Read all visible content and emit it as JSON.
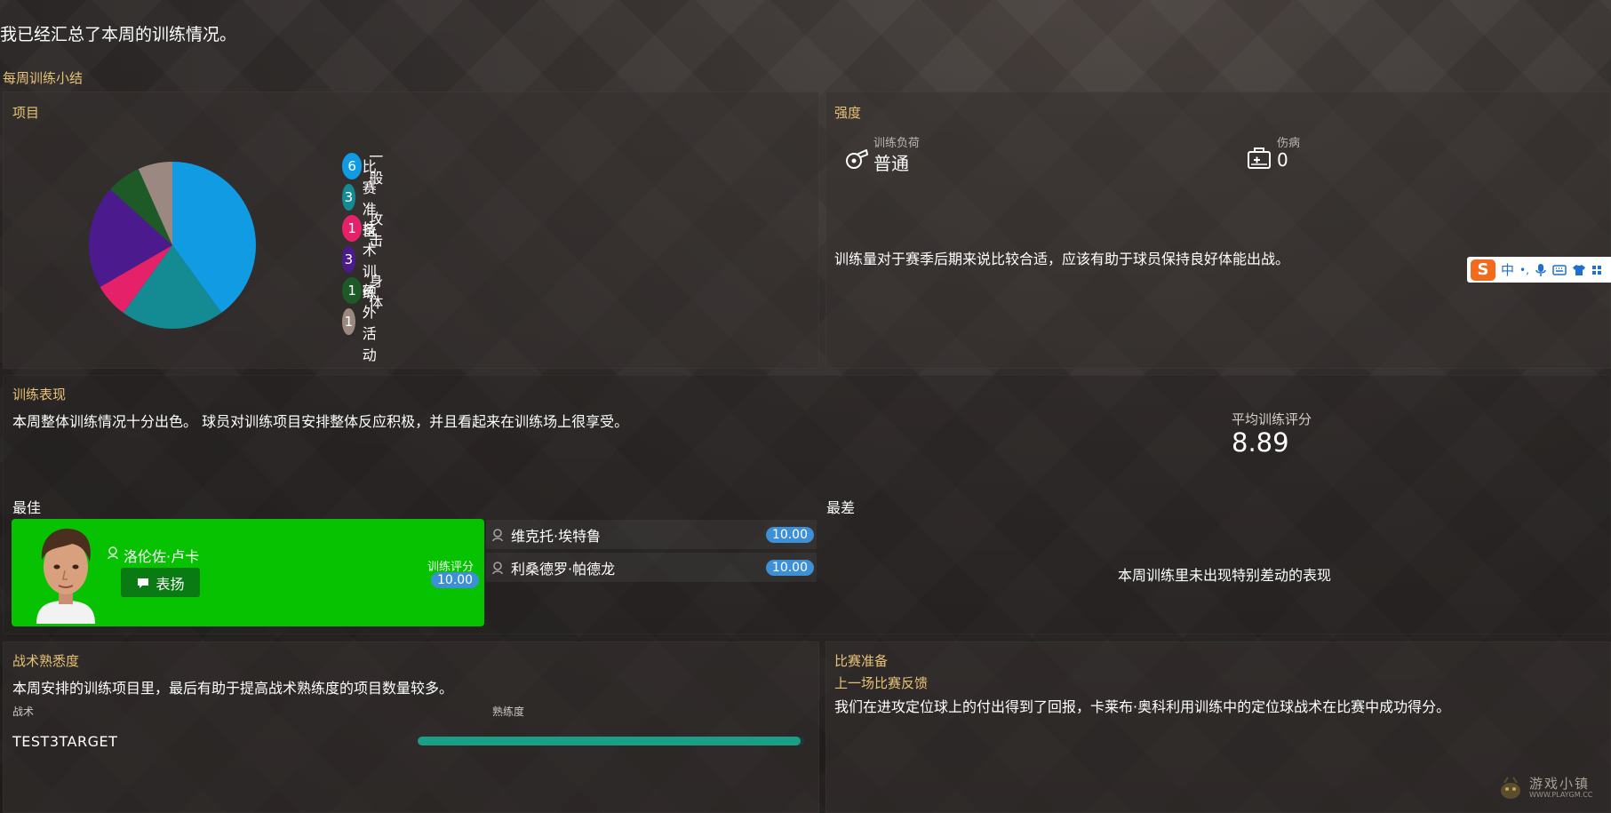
{
  "header": {
    "message": "我已经汇总了本周的训练情况。",
    "summary_title": "每周训练小结"
  },
  "sessions": {
    "title": "项目",
    "items": [
      {
        "count": "6",
        "label": "一般",
        "color": "#109be3"
      },
      {
        "count": "3",
        "label": "比赛准备",
        "color": "#148a93"
      },
      {
        "count": "1",
        "label": "攻击",
        "color": "#e5216a"
      },
      {
        "count": "3",
        "label": "技术训练",
        "color": "#4b1b8e"
      },
      {
        "count": "1",
        "label": "身体",
        "color": "#1e5a28"
      },
      {
        "count": "1",
        "label": "额外活动",
        "color": "#9b8880"
      }
    ]
  },
  "intensity": {
    "title": "强度",
    "load_caption": "训练负荷",
    "load_value": "普通",
    "injury_caption": "伤病",
    "injury_value": "0",
    "comment": "训练量对于赛季后期来说比较合适，应该有助于球员保持良好体能出战。"
  },
  "performance": {
    "title": "训练表现",
    "comment": "本周整体训练情况十分出色。 球员对训练项目安排整体反应积极，并且看起来在训练场上很享受。",
    "avg_caption": "平均训练评分",
    "avg_value": "8.89"
  },
  "best": {
    "title": "最佳",
    "top_player": {
      "name": "洛伦佐·卢卡",
      "praise_label": "表扬",
      "rating_caption": "训练评分",
      "rating": "10.00"
    },
    "others": [
      {
        "name": "维克托·埃特鲁",
        "rating": "10.00"
      },
      {
        "name": "利桑德罗·帕德龙",
        "rating": "10.00"
      }
    ]
  },
  "worst": {
    "title": "最差",
    "empty_text": "本周训练里未出现特别差动的表现"
  },
  "tactics": {
    "title": "战术熟悉度",
    "comment": "本周安排的训练项目里，最后有助于提高战术熟练度的项目数量较多。",
    "col_tactic": "战术",
    "col_familiarity": "熟练度",
    "rows": [
      {
        "name": "TEST3TARGET",
        "familiarity": 0.99
      }
    ]
  },
  "match_prep": {
    "title": "比赛准备",
    "subtitle": "上一场比赛反馈",
    "comment": "我们在进攻定位球上的付出得到了回报，卡莱布·奥科利用训练中的定位球战术在比赛中成功得分。"
  },
  "ime": {
    "logo": "S",
    "mode": "中",
    "punct": "•,"
  },
  "watermark": {
    "name": "游戏小镇",
    "site": "WWW.PLAYGM.CC"
  }
}
